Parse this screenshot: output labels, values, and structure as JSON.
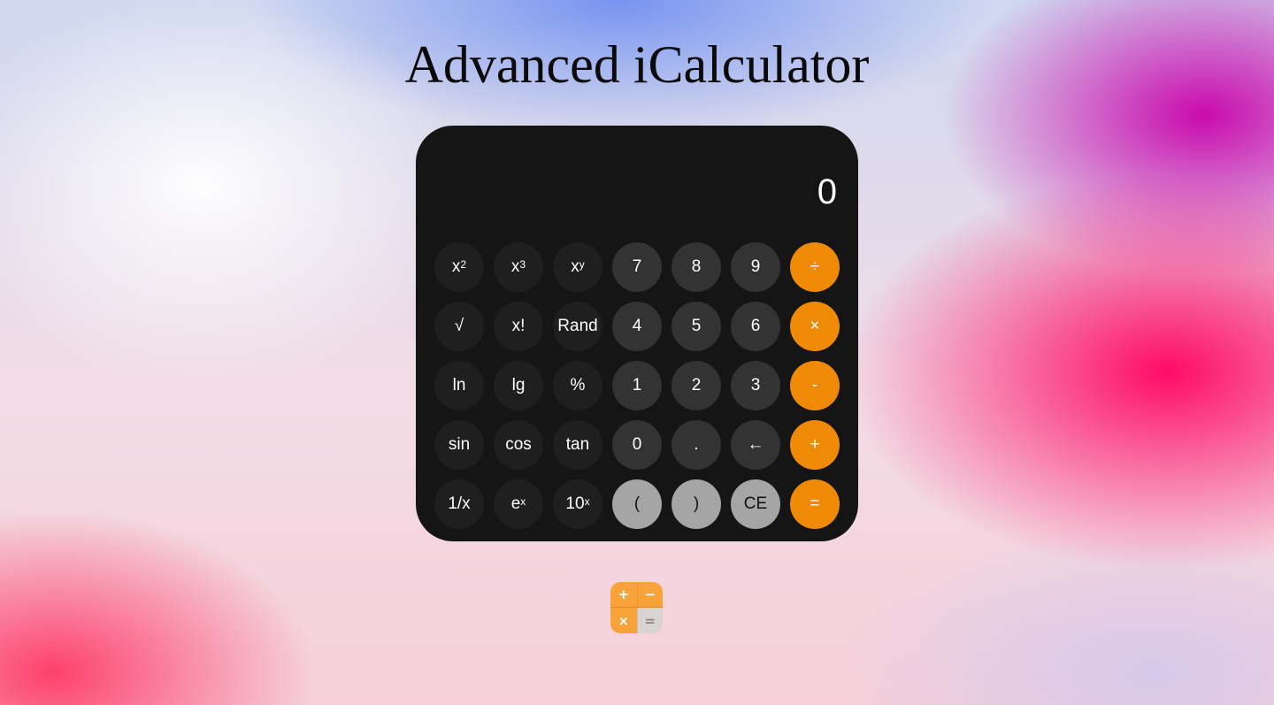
{
  "page": {
    "title": "Advanced iCalculator"
  },
  "calculator": {
    "display": "0",
    "keys": [
      {
        "id": "square",
        "base": "x",
        "sup": "2",
        "kind": "fn"
      },
      {
        "id": "cube",
        "base": "x",
        "sup": "3",
        "kind": "fn"
      },
      {
        "id": "power",
        "base": "x",
        "sup": "y",
        "kind": "fn"
      },
      {
        "id": "seven",
        "label": "7",
        "kind": "num"
      },
      {
        "id": "eight",
        "label": "8",
        "kind": "num"
      },
      {
        "id": "nine",
        "label": "9",
        "kind": "num"
      },
      {
        "id": "divide",
        "label": "÷",
        "kind": "op"
      },
      {
        "id": "sqrt",
        "label": "√",
        "kind": "fn"
      },
      {
        "id": "factorial",
        "label": "x!",
        "kind": "fn"
      },
      {
        "id": "rand",
        "label": "Rand",
        "kind": "fn"
      },
      {
        "id": "four",
        "label": "4",
        "kind": "num"
      },
      {
        "id": "five",
        "label": "5",
        "kind": "num"
      },
      {
        "id": "six",
        "label": "6",
        "kind": "num"
      },
      {
        "id": "multiply",
        "label": "×",
        "kind": "op"
      },
      {
        "id": "ln",
        "label": "ln",
        "kind": "fn"
      },
      {
        "id": "lg",
        "label": "lg",
        "kind": "fn"
      },
      {
        "id": "percent",
        "label": "%",
        "kind": "fn"
      },
      {
        "id": "one",
        "label": "1",
        "kind": "num"
      },
      {
        "id": "two",
        "label": "2",
        "kind": "num"
      },
      {
        "id": "three",
        "label": "3",
        "kind": "num"
      },
      {
        "id": "subtract",
        "label": "-",
        "kind": "op"
      },
      {
        "id": "sin",
        "label": "sin",
        "kind": "fn"
      },
      {
        "id": "cos",
        "label": "cos",
        "kind": "fn"
      },
      {
        "id": "tan",
        "label": "tan",
        "kind": "fn"
      },
      {
        "id": "zero",
        "label": "0",
        "kind": "num"
      },
      {
        "id": "decimal",
        "label": ".",
        "kind": "num"
      },
      {
        "id": "backspace",
        "label": "←",
        "kind": "num"
      },
      {
        "id": "add",
        "label": "+",
        "kind": "op"
      },
      {
        "id": "reciprocal",
        "label": "1/x",
        "kind": "fn"
      },
      {
        "id": "exp",
        "base": "e",
        "sup": "x",
        "kind": "fn"
      },
      {
        "id": "ten-power",
        "base": "10",
        "sup": "x",
        "kind": "fn"
      },
      {
        "id": "open-paren",
        "label": "(",
        "kind": "light"
      },
      {
        "id": "close-paren",
        "label": ")",
        "kind": "light"
      },
      {
        "id": "clear-entry",
        "label": "CE",
        "kind": "light"
      },
      {
        "id": "equals",
        "label": "=",
        "kind": "op"
      }
    ]
  },
  "app_icon": {
    "cells": [
      "+",
      "−",
      "×",
      "="
    ]
  },
  "colors": {
    "calculator_body": "#151515",
    "function_key": "#1f1f1f",
    "number_key": "#333333",
    "light_key": "#a5a5a5",
    "operator_key": "#ee8a06"
  }
}
